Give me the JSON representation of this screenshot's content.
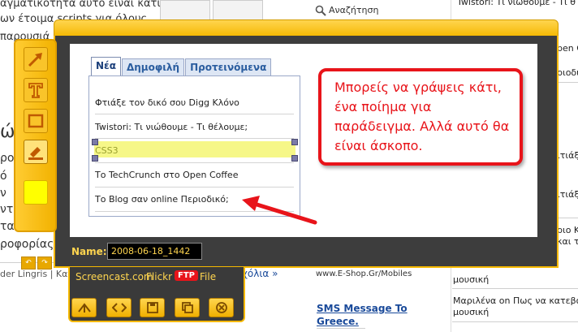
{
  "background_page": {
    "left_text_lines": [
      "αγματικότητα αυτό είναι κάτι",
      "ων έτοιμα scripts για όλους",
      "παρουσιά"
    ],
    "left_fragments": [
      "ώ",
      "ρο",
      "ό",
      "ν",
      "ντι",
      "τα",
      "ροφορίας,"
    ],
    "byline": "der Lingris | Κατηγ",
    "comments_link": "χόλια »",
    "search_label": "Αναζήτηση",
    "right_col_top": "Twistori: Τι νιώθουμε - Τι θ",
    "right_col_items": [
      "pen C",
      "ριοδικ",
      "ιτιάξε",
      "ιτιάξε",
      "ριο Κλ",
      "και τ"
    ],
    "eshop_text": "www.E-Shop.Gr/Mobiles",
    "sms_link_line1": "SMS Message To",
    "sms_link_line2": "Greece.",
    "music_items": [
      "μουσική",
      "Μαριλένα on Πως να κατεβάσ",
      "μουσική"
    ]
  },
  "tabs": [
    {
      "label": "Νέα",
      "active": true
    },
    {
      "label": "Δημοφιλή",
      "active": false
    },
    {
      "label": "Προτεινόμενα",
      "active": false
    }
  ],
  "list_items": [
    "Φτιάξε τον δικό σου Digg Κλόνο",
    "Twistori: Τι νιώθουμε - Τι θέλουμε;",
    "CSS3",
    "Το TechCrunch στο Open Coffee",
    "Το Blog σαν online Περιοδικό;"
  ],
  "callout_text": "Μπορείς να γράψεις κάτι, ένα ποίημα για παράδειγμα. Αλλά αυτό θα είναι άσκοπο.",
  "name_label": "Name:",
  "name_value": "2008-06-18_1442",
  "share": {
    "screencast": "Screencast.com",
    "flickr": "Flickr",
    "ftp": "FTP",
    "file": "File"
  },
  "colors": {
    "accent_yellow": "#f5b800",
    "callout_red": "#e8141a",
    "frame_dark": "#3d3d3d",
    "highlight": "#f6f788"
  }
}
